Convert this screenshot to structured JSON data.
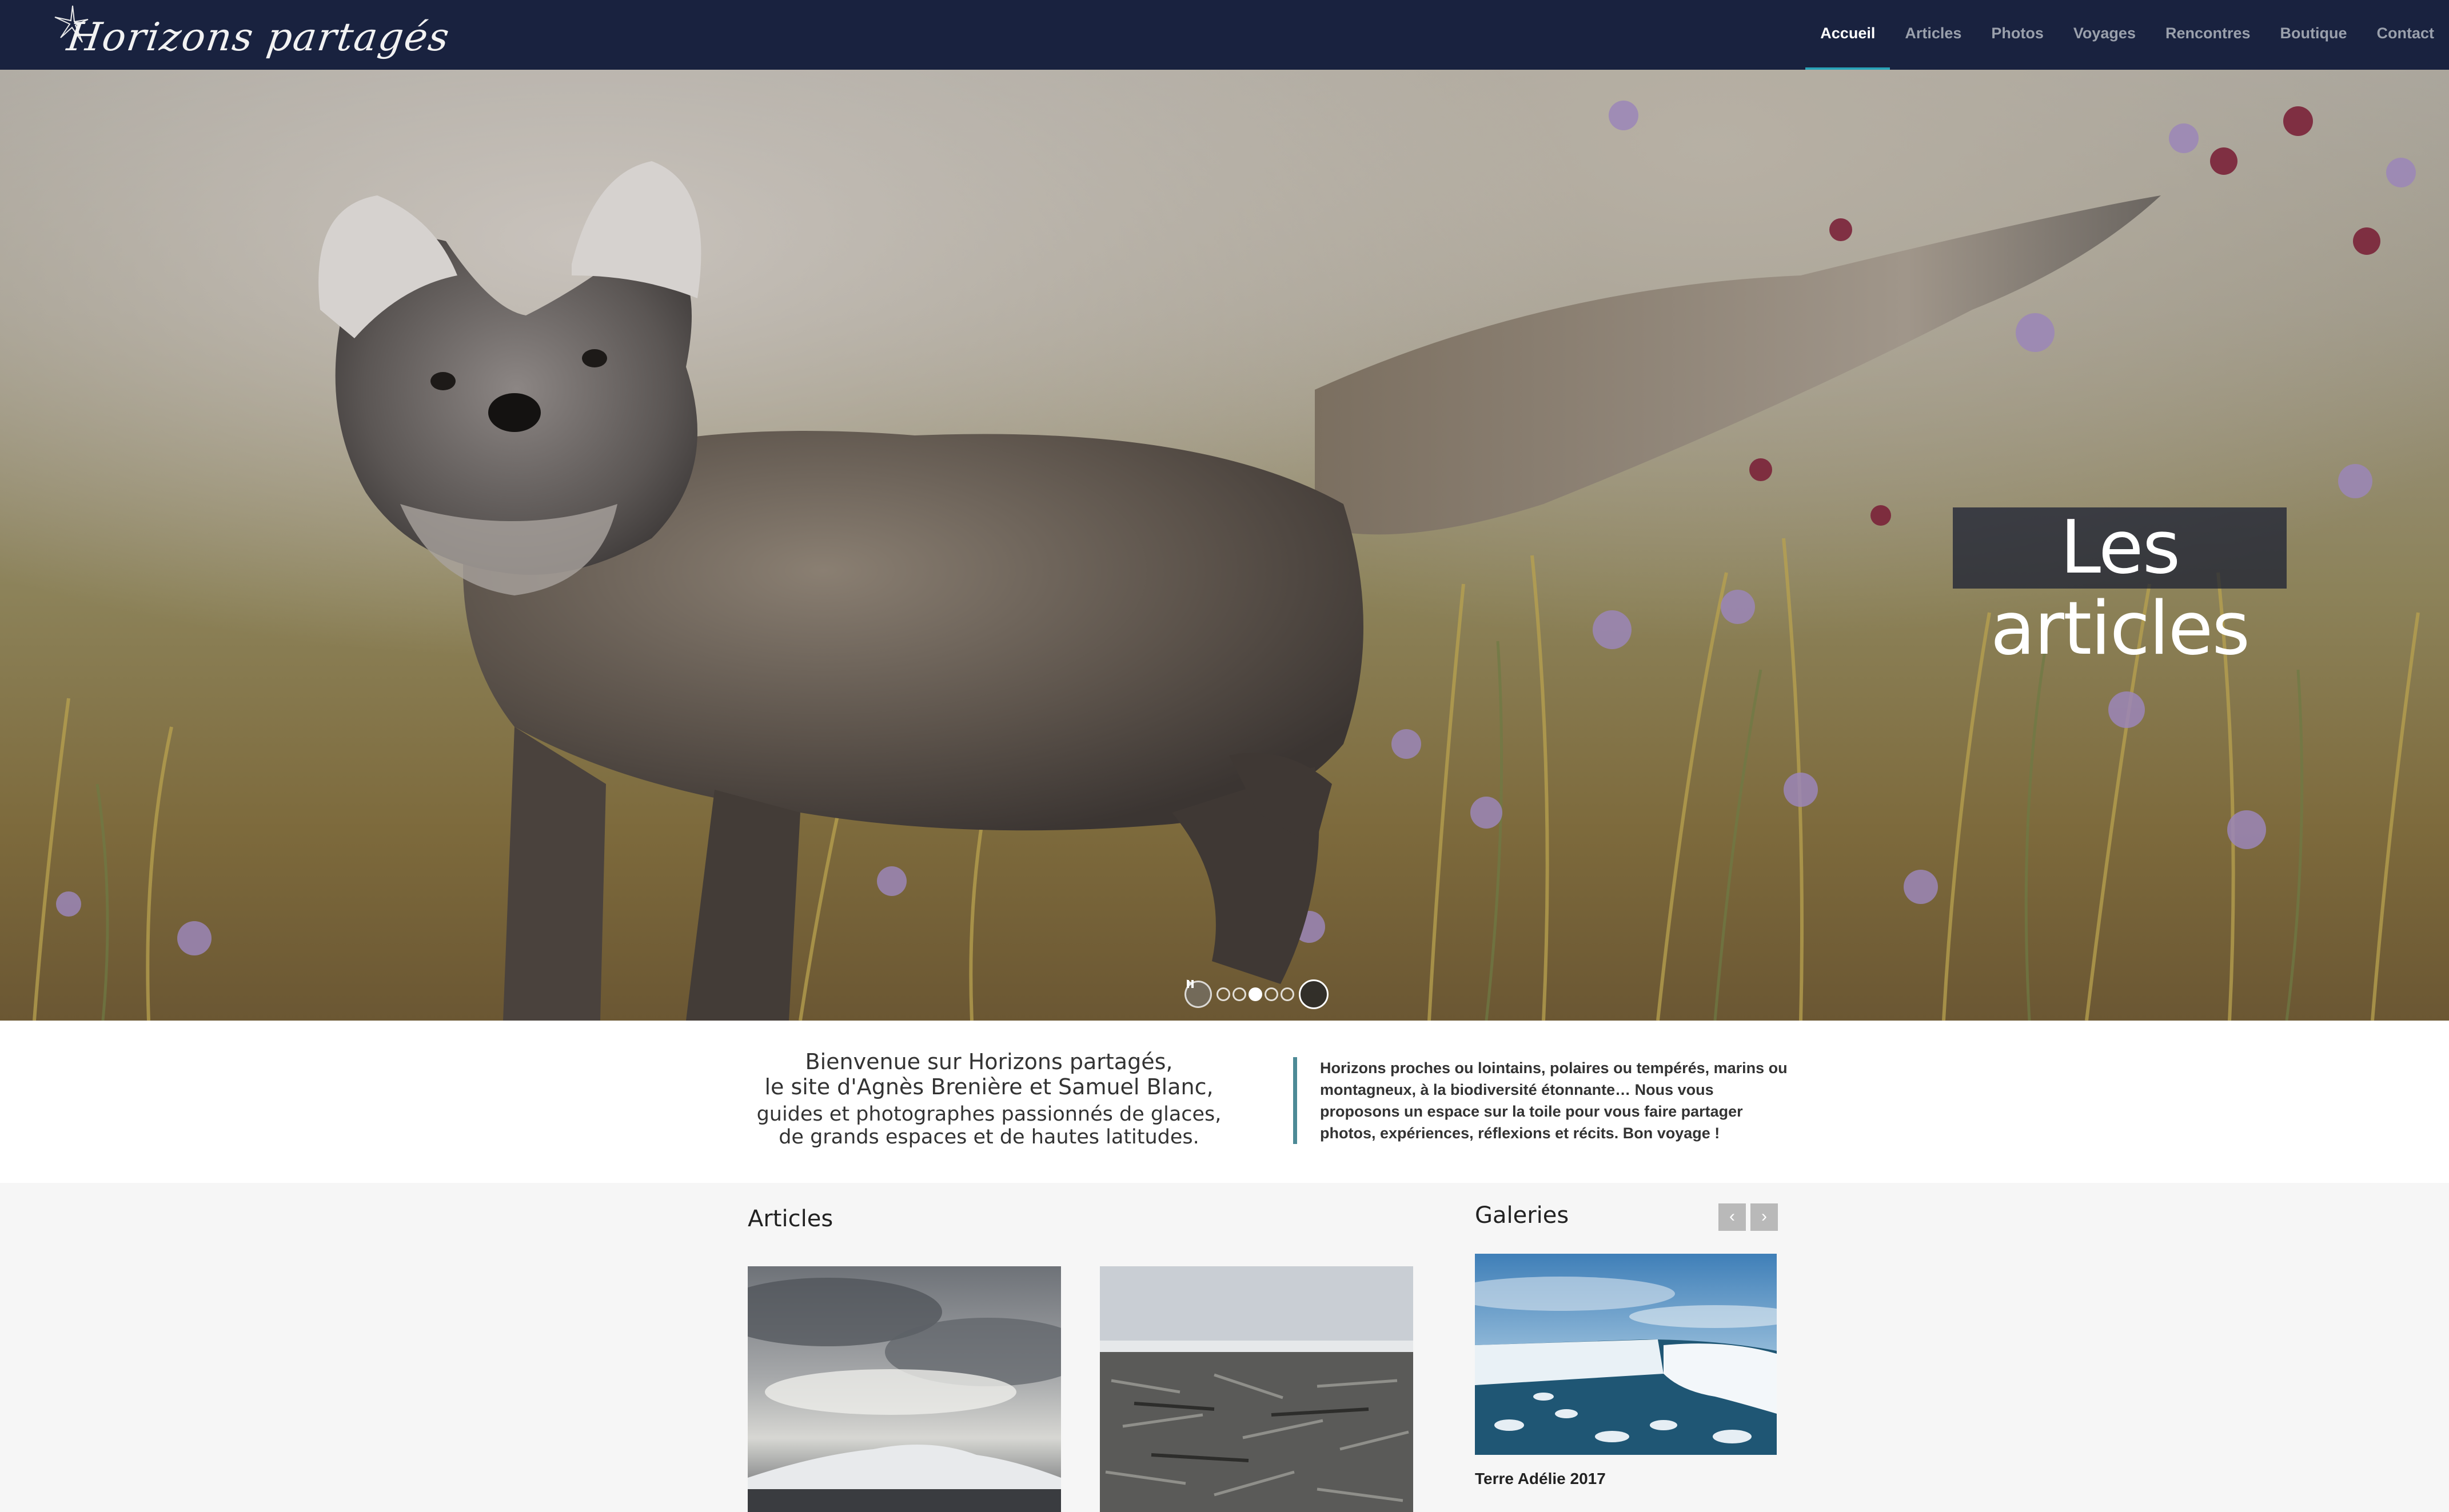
{
  "header": {
    "logo_text": "Horizons partagés",
    "nav": [
      {
        "label": "Accueil",
        "active": true
      },
      {
        "label": "Articles",
        "active": false
      },
      {
        "label": "Photos",
        "active": false
      },
      {
        "label": "Voyages",
        "active": false
      },
      {
        "label": "Rencontres",
        "active": false
      },
      {
        "label": "Boutique",
        "active": false
      },
      {
        "label": "Contact",
        "active": false
      }
    ]
  },
  "hero": {
    "caption": "Les articles",
    "slides_count": 5,
    "active_slide": 3
  },
  "welcome": {
    "line1": "Bienvenue sur Horizons partagés,",
    "line2": "le site d'Agnès Brenière et Samuel Blanc,",
    "line3": "guides et photographes passionnés de glaces,",
    "line4": "de grands espaces et de hautes latitudes.",
    "intro": "Horizons proches ou lointains, polaires ou tempérés, marins ou montagneux, à la biodiversité étonnante… Nous vous proposons un espace sur la toile pour vous faire partager photos, expériences, réflexions et récits. Bon voyage !"
  },
  "articles": {
    "title": "Articles"
  },
  "galleries": {
    "title": "Galeries",
    "prev": "‹",
    "next": "›",
    "item_caption": "Terre Adélie 2017"
  },
  "colors": {
    "header_bg": "#19223f",
    "nav_active": "#ffffff",
    "nav_inactive": "#9aa0ac",
    "accent": "#2aa3b8",
    "quote_border": "#4d8a96"
  }
}
